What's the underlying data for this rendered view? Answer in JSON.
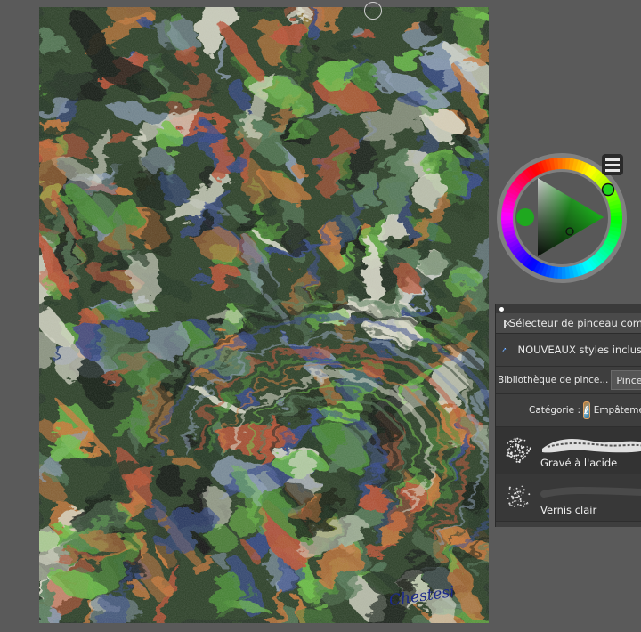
{
  "artwork": {
    "signature": "Chestesi",
    "palette": [
      "#2a3a2a",
      "#4e8c3a",
      "#6fbf4a",
      "#3a4d8a",
      "#b9553a",
      "#d9d9c9",
      "#1a1f1a",
      "#8a9bb0",
      "#c77a3e",
      "#5a7d5c"
    ]
  },
  "color_wheel": {
    "current_color": "#1fb51f",
    "menu_icon": "hamburger-icon"
  },
  "brush_panel": {
    "title": "Sélecteur de pinceau compact",
    "new_styles_label": "NOUVEAUX styles inclus",
    "library_label": "Bibliothèque de pince...",
    "library_value": "Pinceaux Pa",
    "category_label": "Catégorie :",
    "category_value": "Empâtement",
    "brushes": [
      {
        "name": "Gravé à l'acide"
      },
      {
        "name": "Vernis clair"
      }
    ]
  }
}
